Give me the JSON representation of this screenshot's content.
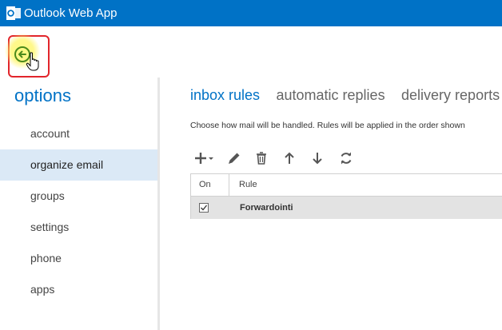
{
  "app": {
    "title": "Outlook Web App"
  },
  "sidebar": {
    "title": "options",
    "items": [
      {
        "label": "account"
      },
      {
        "label": "organize email",
        "selected": true
      },
      {
        "label": "groups"
      },
      {
        "label": "settings"
      },
      {
        "label": "phone"
      },
      {
        "label": "apps"
      }
    ]
  },
  "tabs": [
    {
      "label": "inbox rules",
      "active": true
    },
    {
      "label": "automatic replies"
    },
    {
      "label": "delivery reports"
    }
  ],
  "description": "Choose how mail will be handled. Rules will be applied in the order shown",
  "toolbar": {
    "icons": [
      "add-icon",
      "edit-icon",
      "delete-icon",
      "move-up-icon",
      "move-down-icon",
      "refresh-icon"
    ]
  },
  "table": {
    "headers": {
      "on": "On",
      "rule": "Rule"
    },
    "rows": [
      {
        "checked": true,
        "name": "Forwardointi"
      }
    ]
  },
  "colors": {
    "brand": "#0072c6",
    "selected_nav": "#dbe9f6",
    "highlight_border": "#e2252b"
  }
}
